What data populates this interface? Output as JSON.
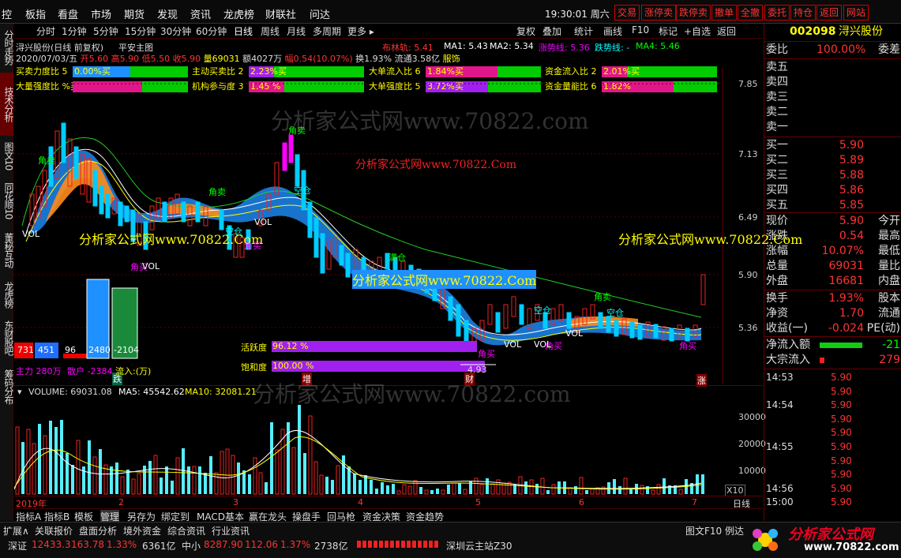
{
  "menu": {
    "items": [
      "控",
      "板指",
      "看盘",
      "市场",
      "期货",
      "发现",
      "资讯",
      "龙虎榜",
      "财联社",
      "问达"
    ],
    "time": "19:30:01 周六",
    "buttons": [
      "交易",
      "涨停卖",
      "跌停卖",
      "撤单",
      "全撤",
      "委托",
      "持仓",
      "返回",
      "网站"
    ]
  },
  "lefttabs": [
    "分时走势",
    "技术分析",
    "图文10",
    "同花顺10",
    "董秘互动",
    "龙虎榜",
    "东财股吧",
    "筹码分布"
  ],
  "period": {
    "items": [
      "分时",
      "1分钟",
      "5分钟",
      "15分钟",
      "30分钟",
      "60分钟",
      "日线",
      "周线",
      "月线",
      "多周期",
      "更多 ▸"
    ],
    "right": [
      "复权",
      "叠加",
      "统计",
      "画线",
      "F10",
      "标记",
      "+自选",
      "返回"
    ]
  },
  "stock": {
    "title": "浔兴股份(日线 前复权)",
    "formula": "平安主图",
    "boll": "布林轨: 5.41",
    "ma1": "MA1: 5.43",
    "ma2": "MA2: 5.34",
    "up": "涨势线: 5.36",
    "down": "跌势线: -",
    "ma4": "MA4: 5.46",
    "date": "2020/07/03/五",
    "open": "开5.60",
    "high": "高5.90",
    "low": "低5.50",
    "close": "收5.90",
    "vol": "量69031",
    "amt": "额4027万",
    "amp": "幅0.54(10.07%)",
    "turn": "换1.93%",
    "flow": "流通3.58亿",
    "industry": "服饰"
  },
  "indicators": [
    {
      "label": "买卖力度比 5",
      "value": "0.00%买",
      "fill": 0.5,
      "color": "#1e90ff"
    },
    {
      "label": "主动买卖比 2",
      "value": "2.23%买",
      "fill": 0.22,
      "color": "#a020f0"
    },
    {
      "label": "大单流入比 6",
      "value": "1.84%买",
      "fill": 0.62,
      "color": "#e0168a"
    },
    {
      "label": "资金流入比 2",
      "value": "2.01%买",
      "fill": 0.22,
      "color": "#e0168a"
    },
    {
      "label": "大量强度比 %买",
      "value": "",
      "fill": 0.6,
      "color": "#e0168a"
    },
    {
      "label": "机构参与度 3",
      "value": "1.45 %",
      "fill": 0.31,
      "color": "#e0168a"
    },
    {
      "label": "大单强度比 5",
      "value": "3.72%买",
      "fill": 0.54,
      "color": "#a020f0"
    },
    {
      "label": "资金量能比 6",
      "value": "1.82%",
      "fill": 0.62,
      "color": "#e0168a"
    }
  ],
  "prices": [
    "7.85",
    "7.13",
    "6.49",
    "5.90",
    "5.36"
  ],
  "annotations": {
    "jiaomai": [
      "角卖",
      "角卖",
      "角卖",
      "角卖"
    ],
    "jiaomai2": [
      "角买",
      "角买",
      "角买",
      "角买",
      "角买"
    ],
    "kongcang": [
      "空仓",
      "空仓",
      "空仓",
      "空仓"
    ],
    "vol": [
      "VOL",
      "VOL",
      "VOL",
      "VOL",
      "VOL",
      "VOL"
    ],
    "zeng": "增",
    "cai": "财",
    "zhang": "涨",
    "die": "跌",
    "min": "4.93",
    "maicang": "满仓"
  },
  "flow": {
    "values": [
      "731",
      "451",
      "96",
      "2480",
      "-2104"
    ],
    "zhuli": "主力 280万",
    "sanhu": "散户 -2384",
    "inflow": "流入:(万)"
  },
  "activity": {
    "huoyue": "活跃度",
    "huoyue_val": "96.12 %",
    "huoyue_fill": 0.96,
    "baohe": "饱和度",
    "baohe_val": "100.00 %",
    "baohe_fill": 1.0
  },
  "volume": {
    "header": "VOLUME: 69031.08",
    "ma5": "MA5: 45542.62",
    "ma10": "MA10: 32081.21",
    "ticks": [
      "30000",
      "20000",
      "10000"
    ],
    "x10": "X10"
  },
  "dates": [
    "2019年",
    "2",
    "3",
    "4",
    "5",
    "6",
    "7"
  ],
  "period_label": "日线",
  "watermarks": [
    "分析家公式网www.70822.com",
    "分析家公式网www.70822.Com",
    "分析家公式网www.70822.Com",
    "分析家公式网www.70822.Com",
    "分析家公式网www.70822.Com",
    "分析家公式网www.70822.com"
  ],
  "right": {
    "code": "002098",
    "name": "浔兴股份",
    "weibi_label": "委比",
    "weibi": "100.00%",
    "weicha": "委差",
    "asks": [
      {
        "label": "卖五",
        "price": ""
      },
      {
        "label": "卖四",
        "price": ""
      },
      {
        "label": "卖三",
        "price": ""
      },
      {
        "label": "卖二",
        "price": ""
      },
      {
        "label": "卖一",
        "price": ""
      }
    ],
    "bids": [
      {
        "label": "买一",
        "price": "5.90"
      },
      {
        "label": "买二",
        "price": "5.89"
      },
      {
        "label": "买三",
        "price": "5.88"
      },
      {
        "label": "买四",
        "price": "5.86"
      },
      {
        "label": "买五",
        "price": "5.85"
      }
    ],
    "quote": [
      {
        "l": "现价",
        "v": "5.90",
        "r": "今开"
      },
      {
        "l": "涨跌",
        "v": "0.54",
        "r": "最高"
      },
      {
        "l": "涨幅",
        "v": "10.07%",
        "r": "最低"
      },
      {
        "l": "总量",
        "v": "69031",
        "r": "量比"
      },
      {
        "l": "外盘",
        "v": "16681",
        "r": "内盘"
      }
    ],
    "quote2": [
      {
        "l": "换手",
        "v": "1.93%",
        "r": "股本"
      },
      {
        "l": "净资",
        "v": "1.70",
        "r": "流通"
      },
      {
        "l": "收益(一)",
        "v": "-0.024",
        "r": "PE(动)"
      }
    ],
    "netflow_label": "净流入额",
    "netflow": "-21",
    "bigflow_label": "大宗流入",
    "bigflow": "279",
    "ticks": [
      {
        "t": "14:53",
        "p": "5.90"
      },
      {
        "t": "",
        "p": "5.90"
      },
      {
        "t": "14:54",
        "p": "5.90"
      },
      {
        "t": "",
        "p": "5.90"
      },
      {
        "t": "",
        "p": "5.90"
      },
      {
        "t": "14:55",
        "p": "5.90"
      },
      {
        "t": "",
        "p": "5.90"
      },
      {
        "t": "",
        "p": "5.90"
      },
      {
        "t": "14:56",
        "p": "5.90"
      },
      {
        "t": "15:00",
        "p": "5.90"
      }
    ]
  },
  "bottomtabs": [
    "指标A",
    "指标B",
    "模板",
    "管理",
    "另存为",
    "绑定到",
    "MACD基本",
    "赢在龙头",
    "操盘手",
    "回马枪",
    "资金决策",
    "资金趋势"
  ],
  "statusbar": {
    "tabs": [
      "扩展∧",
      "关联报价",
      "盘面分析",
      "境外资金",
      "综合资讯",
      "行业资讯"
    ],
    "right_tabs": [
      "图文F10",
      "例达"
    ],
    "sz": "深证",
    "sz_val": "12433.3",
    "sz_chg": "163.78",
    "sz_pct": "1.33%",
    "sz_amt": "6361亿",
    "zx": "中小",
    "zx_val": "8287.90",
    "zx_chg": "112.06",
    "zx_pct": "1.37%",
    "zx_amt": "2738亿",
    "station": "深圳云主站Z30",
    "logo": "分析家公式网",
    "logo_url": "www.70822.com"
  }
}
